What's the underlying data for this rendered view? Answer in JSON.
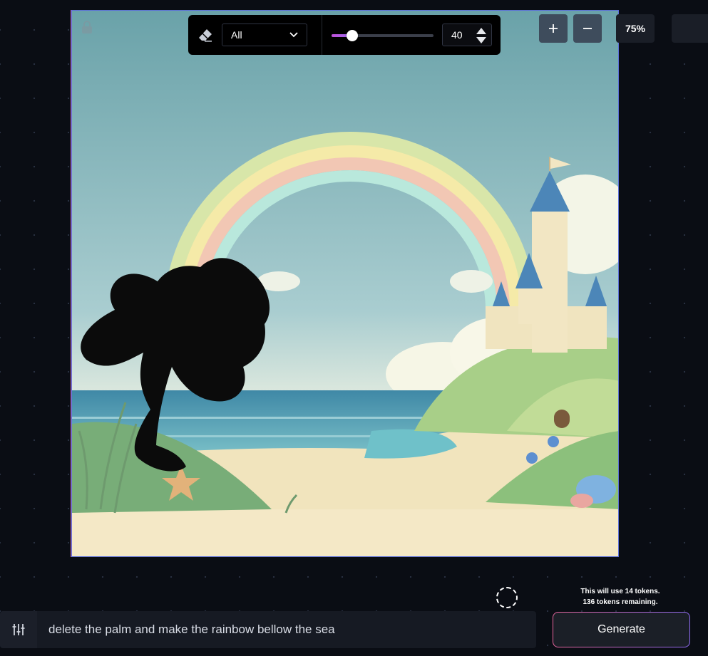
{
  "toolbar": {
    "mask_mode": "All",
    "brush_size": "40",
    "brush_size_fraction": 0.2
  },
  "zoom": {
    "level": "75%"
  },
  "prompt": {
    "text": "delete the palm and make the rainbow bellow the sea"
  },
  "tokens": {
    "usage": "This will use 14 tokens.",
    "remaining": "136 tokens remaining."
  },
  "generate": {
    "label": "Generate"
  },
  "colors": {
    "accent_pink": "#e8659c",
    "accent_purple": "#8f6bf3",
    "zoom_button": "#3e4c5c",
    "background": "#0a0d14"
  },
  "icons": {
    "eraser": "eraser-icon",
    "dropdown": "chevron-down-icon",
    "zoom_in": "plus-icon",
    "zoom_out": "minus-icon",
    "settings": "sliders-icon",
    "lock": "lock-icon"
  }
}
